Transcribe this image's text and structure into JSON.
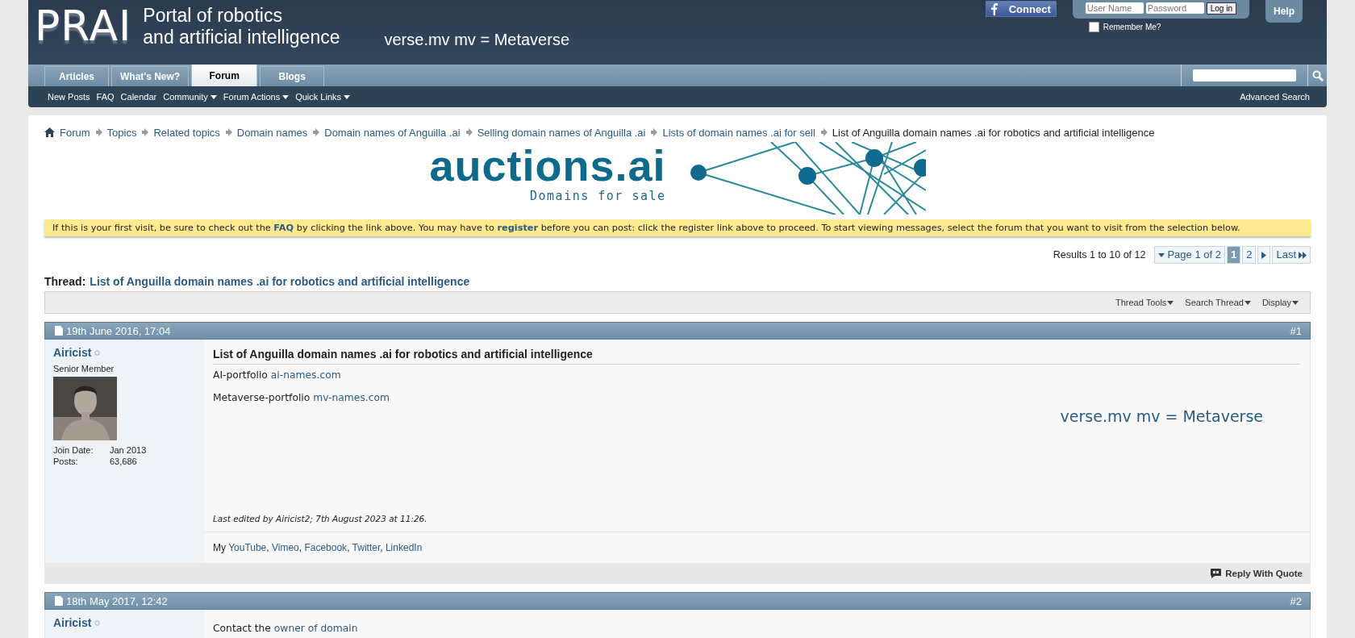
{
  "header": {
    "logo": "PRAI",
    "tagline": [
      "Portal of robotics",
      "and artificial intelligence"
    ],
    "slogan": "verse.mv mv = Metaverse",
    "facebook": "Connect",
    "login": {
      "username_placeholder": "User Name",
      "password_placeholder": "Password",
      "button": "Log in",
      "remember": {
        "label": "Remember Me?",
        "checked": false
      }
    },
    "help": "Help"
  },
  "tabs": [
    {
      "label": "Articles",
      "selected": false
    },
    {
      "label": "What's New?",
      "selected": false
    },
    {
      "label": "Forum",
      "selected": true
    },
    {
      "label": "Blogs",
      "selected": false
    }
  ],
  "subnav": [
    {
      "label": "New Posts",
      "dropdown": false
    },
    {
      "label": "FAQ",
      "dropdown": false
    },
    {
      "label": "Calendar",
      "dropdown": false
    },
    {
      "label": "Community",
      "dropdown": true
    },
    {
      "label": "Forum Actions",
      "dropdown": true
    },
    {
      "label": "Quick Links",
      "dropdown": true
    }
  ],
  "advanced_search": "Advanced Search",
  "breadcrumb": [
    {
      "label": "Forum",
      "current": false
    },
    {
      "label": "Topics",
      "current": false
    },
    {
      "label": "Related topics",
      "current": false
    },
    {
      "label": "Domain names",
      "current": false
    },
    {
      "label": "Domain names of Anguilla .ai",
      "current": false
    },
    {
      "label": "Selling domain names of Anguilla .ai",
      "current": false
    },
    {
      "label": "Lists of domain names .ai for sell",
      "current": false
    },
    {
      "label": "List of Anguilla domain names .ai for robotics and artificial intelligence",
      "current": true
    }
  ],
  "banner": {
    "title": "auctions.ai",
    "subtitle": "Domains for sale"
  },
  "notice": [
    {
      "kind": "text",
      "text": "If this is your first visit, be sure to check out the "
    },
    {
      "kind": "link",
      "text": "FAQ"
    },
    {
      "kind": "text",
      "text": " by clicking the link above. You may have to "
    },
    {
      "kind": "link",
      "text": "register"
    },
    {
      "kind": "text",
      "text": " before you can post: click the register link above to proceed. To start viewing messages, select the forum that you want to visit from the selection below."
    }
  ],
  "pagination": {
    "results": "Results 1 to 10 of 12",
    "page_label": "Page 1 of 2",
    "pages": [
      {
        "label": "1",
        "selected": true
      },
      {
        "label": "2",
        "selected": false
      }
    ],
    "last": "Last"
  },
  "thread": {
    "label": "Thread:",
    "title": "List of Anguilla domain names .ai for robotics and artificial intelligence"
  },
  "thread_tools": [
    "Thread Tools",
    "Search Thread",
    "Display"
  ],
  "posts": [
    {
      "date": "19th June 2016, 17:04",
      "number": "#1",
      "user": "Airicist",
      "online": false,
      "rank": "Senior Member",
      "avatar": {
        "kind": "picture"
      },
      "stats": [
        {
          "label": "Join Date:",
          "value": "Jan 2013"
        },
        {
          "label": "Posts:",
          "value": "63,686"
        }
      ],
      "title": "List of Anguilla domain names .ai for robotics and artificial intelligence",
      "lines": [
        [
          {
            "kind": "text",
            "text": "AI-portfolio "
          },
          {
            "kind": "link",
            "text": "ai-names.com"
          }
        ],
        [
          {
            "kind": "text",
            "text": "Metaverse-portfolio "
          },
          {
            "kind": "link",
            "text": "mv-names.com"
          }
        ]
      ],
      "big_note": "verse.mv mv = Metaverse",
      "edited": "Last edited by Airicist2; 7th August 2023 at 11:26.",
      "signature": [
        {
          "kind": "text",
          "text": "My "
        },
        {
          "kind": "link",
          "text": "YouTube"
        },
        {
          "kind": "text",
          "text": ", "
        },
        {
          "kind": "link",
          "text": "Vimeo"
        },
        {
          "kind": "text",
          "text": ", "
        },
        {
          "kind": "link",
          "text": "Facebook"
        },
        {
          "kind": "text",
          "text": ", "
        },
        {
          "kind": "link",
          "text": "Twitter"
        },
        {
          "kind": "text",
          "text": ", "
        },
        {
          "kind": "link",
          "text": "LinkedIn"
        }
      ],
      "reply": "Reply With Quote"
    },
    {
      "date": "18th May 2017, 12:42",
      "number": "#2",
      "user": "Airicist",
      "online": false,
      "lines": [
        [
          {
            "kind": "text",
            "text": "Contact the "
          },
          {
            "kind": "link",
            "text": "owner of domain"
          }
        ]
      ]
    }
  ]
}
